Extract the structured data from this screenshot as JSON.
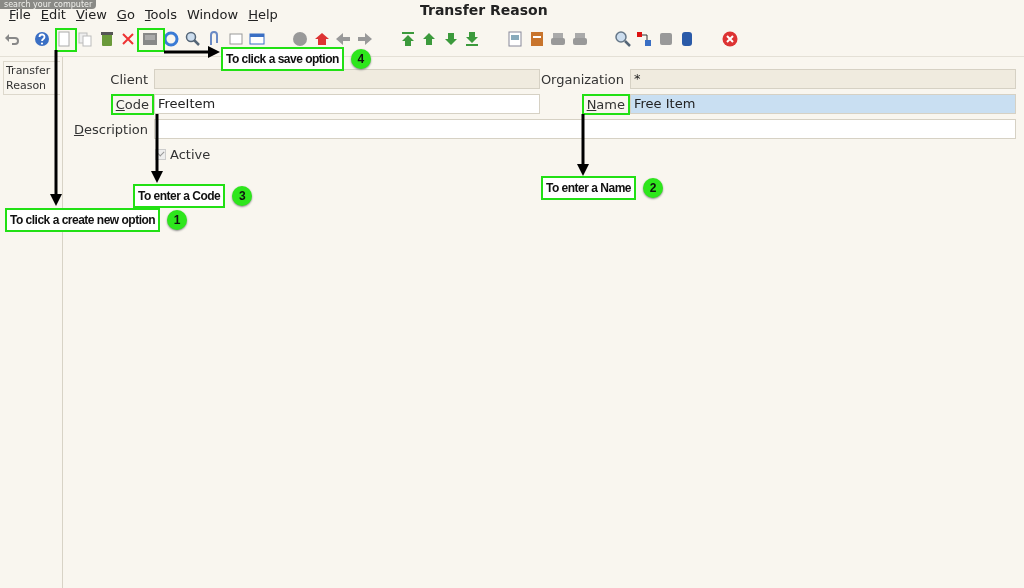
{
  "menu": [
    {
      "label": "File",
      "mnemonic": true
    },
    {
      "label": "Edit",
      "mnemonic": true
    },
    {
      "label": "View",
      "mnemonic": true
    },
    {
      "label": "Go",
      "mnemonic": true
    },
    {
      "label": "Tools",
      "mnemonic": true
    },
    {
      "label": "Window",
      "mnemonic": false
    },
    {
      "label": "Help",
      "mnemonic": true
    }
  ],
  "window": {
    "title": "Transfer Reason"
  },
  "tooltip": "search your computer",
  "sidebar": {
    "tabs": [
      {
        "label": "Transfer Reason",
        "selected": true
      }
    ]
  },
  "form": {
    "client": {
      "label": "Client"
    },
    "organization": {
      "label": "Organization",
      "value": "*"
    },
    "code": {
      "label": "Code",
      "value": "FreeItem",
      "mnemonic": true,
      "highlighted": true
    },
    "name": {
      "label": "Name",
      "value": "Free Item",
      "mnemonic": true,
      "focused": true,
      "highlighted": true
    },
    "description": {
      "label": "Description",
      "mnemonic": true
    },
    "active": {
      "label": "Active",
      "checked": true
    }
  },
  "annotations": [
    {
      "text": "To click a create new option",
      "number": "1"
    },
    {
      "text": "To enter  a Name",
      "number": "2"
    },
    {
      "text": "To enter a Code",
      "number": "3"
    },
    {
      "text": "To click a save option",
      "number": "4"
    }
  ]
}
